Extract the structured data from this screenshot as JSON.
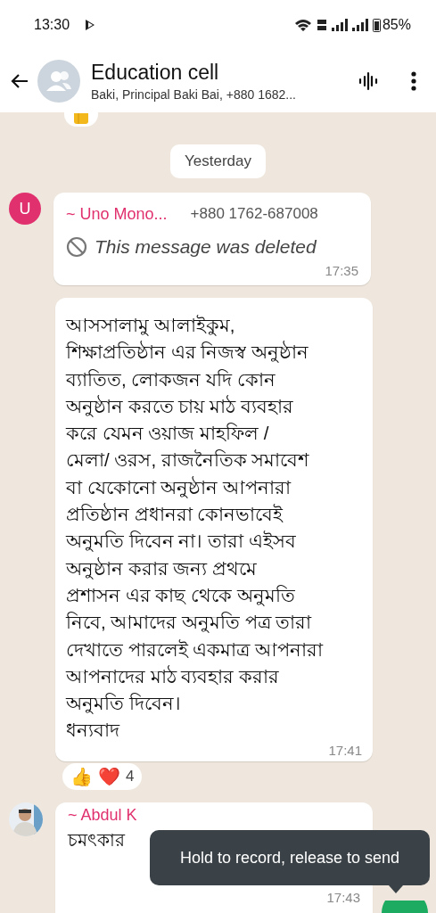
{
  "status_bar": {
    "time": "13:30",
    "battery": "85%"
  },
  "header": {
    "title": "Education cell",
    "subtitle": "Baki, Principal Baki Bai, +880 1682..."
  },
  "messages": [
    {
      "kind": "reaction_stub"
    },
    {
      "kind": "date",
      "text": "Yesterday"
    },
    {
      "kind": "deleted",
      "avatar_letter": "U",
      "color": "#e0306e",
      "sender": "~ Uno Mono...",
      "phone": "+880 1762-687008",
      "text": "This message was deleted",
      "time": "17:35"
    },
    {
      "kind": "text",
      "text": "আসসালামু আলাইকুম,\nশিক্ষাপ্রতিষ্ঠান এর নিজস্ব অনুষ্ঠান\nব্যাতিত, লোকজন যদি কোন\nঅনুষ্ঠান করতে চায় মাঠ ব্যবহার\nকরে যেমন ওয়াজ মাহফিল /\nমেলা/ ওরস, রাজনৈতিক সমাবেশ\nবা যেকোনো অনুষ্ঠান আপনারা\nপ্রতিষ্ঠান প্রধানরা কোনভাবেই\nঅনুমতি দিবেন না। তারা এইসব\nঅনুষ্ঠান করার জন্য প্রথমে\nপ্রশাসন এর কাছ থেকে অনুমতি\nনিবে, আমাদের অনুমতি পত্র তারা\nদেখাতে পারলেই একমাত্র আপনারা\nআপনাদের মাঠ ব্যবহার করার\nঅনুমতি দিবেন।\nধন্যবাদ",
      "time": "17:41"
    },
    {
      "kind": "reactions",
      "emojis": [
        "👍",
        "❤️"
      ],
      "count": "4"
    },
    {
      "color": "#e0306e",
      "sender": "~ Abdul K",
      "text": "চমৎকার",
      "time": "17:43"
    }
  ],
  "tooltip": "Hold to record, release to send"
}
